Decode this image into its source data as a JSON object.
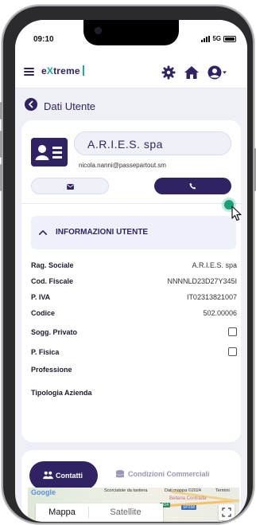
{
  "status_bar": {
    "time": "09:10",
    "network": "5G"
  },
  "header": {
    "logo_prefix": "e",
    "logo_x": "X",
    "logo_suffix": "treme",
    "icons": [
      "menu-icon",
      "gear-icon",
      "home-icon",
      "user-icon"
    ]
  },
  "page": {
    "title": "Dati Utente"
  },
  "user": {
    "name": "A.R.I.E.S. spa",
    "email": "nicola.nanni@passepartout.sm"
  },
  "section": {
    "title": "INFORMAZIONI UTENTE",
    "expanded": true
  },
  "fields": [
    {
      "label": "Rag. Sociale",
      "value": "A.R.I.E.S. spa",
      "type": "text"
    },
    {
      "label": "Cod. Fiscale",
      "value": "NNNNLD23D27Y345I",
      "type": "text"
    },
    {
      "label": "P. IVA",
      "value": "IT02313821007",
      "type": "text"
    },
    {
      "label": "Codice",
      "value": "502.00006",
      "type": "text"
    },
    {
      "label": "Sogg. Privato",
      "value": false,
      "type": "checkbox"
    },
    {
      "label": "P. Fisica",
      "value": false,
      "type": "checkbox"
    },
    {
      "label": "Professione",
      "value": "",
      "type": "text"
    },
    {
      "label": "Tipologia Azienda",
      "value": "",
      "type": "text"
    }
  ],
  "tabs": {
    "active": "Contatti",
    "inactive": "Condizioni Commerciali"
  },
  "map": {
    "provider": "Google",
    "attribution_shortcuts": "Scorciatoie da tastiera",
    "attribution_data": "Dati mappa ©2024",
    "attribution_terms": "Termini",
    "btn_map": "Mappa",
    "btn_satellite": "Satellite",
    "place_label": "Bellaria Contrada",
    "road_a14": "A14",
    "road_sp": "SP258"
  },
  "colors": {
    "primary": "#312363",
    "accent": "#20a8a0",
    "background": "#eef0f6",
    "touch": "#1aa07a"
  }
}
